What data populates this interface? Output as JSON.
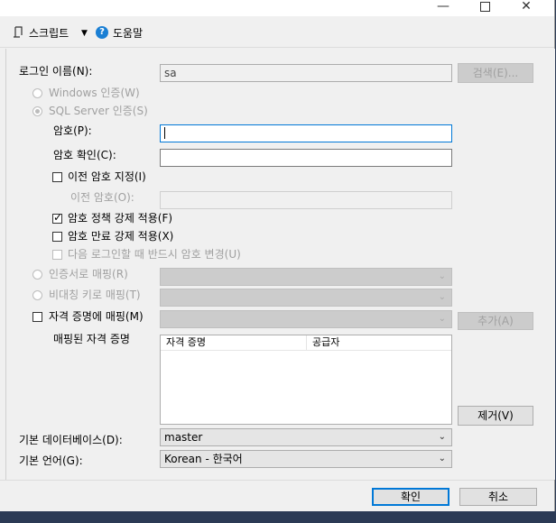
{
  "window": {
    "minimize": "—",
    "close": "✕"
  },
  "toolbar": {
    "script_label": "스크립트",
    "script_arrow": "▼",
    "help_label": "도움말",
    "help_glyph": "?"
  },
  "form": {
    "login_name_label": "로그인 이름(N):",
    "login_name_value": "sa",
    "search_button": "검색(E)...",
    "windows_auth_label": "Windows 인증(W)",
    "sql_auth_label": "SQL Server 인증(S)",
    "password_label": "암호(P):",
    "confirm_password_label": "암호 확인(C):",
    "specify_old_password_label": "이전 암호 지정(I)",
    "old_password_label": "이전 암호(O):",
    "enforce_policy_label": "암호 정책 강제 적용(F)",
    "enforce_policy_checked": true,
    "enforce_expiration_label": "암호 만료 강제 적용(X)",
    "must_change_label": "다음 로그인할 때 반드시 암호 변경(U)",
    "cert_mapping_label": "인증서로 매핑(R)",
    "asym_key_mapping_label": "비대칭 키로 매핑(T)",
    "credential_mapping_label": "자격 증명에 매핑(M)",
    "add_button": "추가(A)",
    "mapped_credentials_label": "매핑된 자격 증명",
    "columns": [
      "자격 증명",
      "공급자"
    ],
    "remove_button": "제거(V)",
    "default_db_label": "기본 데이터베이스(D):",
    "default_db_value": "master",
    "default_lang_label": "기본 언어(G):",
    "default_lang_value": "Korean - 한국어",
    "dropdown_glyph": "⌄"
  },
  "footer": {
    "ok_button": "확인",
    "cancel_button": "취소"
  }
}
